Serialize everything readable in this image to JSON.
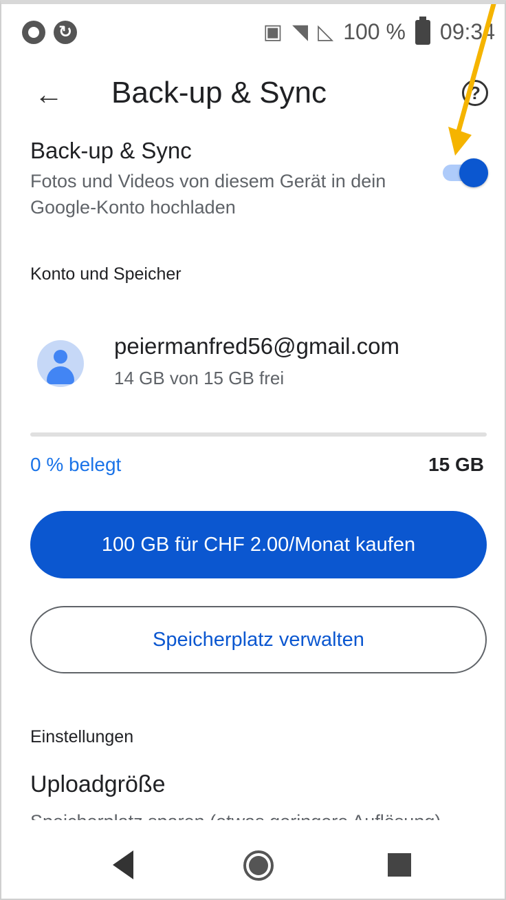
{
  "status_bar": {
    "battery": "100 %",
    "time": "09:34",
    "icons": [
      "circle-icon",
      "sync-icon",
      "cast-icon",
      "wifi-icon",
      "no-sim-icon",
      "battery-icon"
    ]
  },
  "toolbar": {
    "back_icon": "arrow-back-icon",
    "title": "Back-up & Sync",
    "help_icon": "help-icon"
  },
  "backup_setting": {
    "title": "Back-up & Sync",
    "description": "Fotos und Videos von diesem Gerät in dein Google-Konto hochladen",
    "enabled": true
  },
  "account_section": {
    "header": "Konto und Speicher",
    "email": "peiermanfred56@gmail.com",
    "storage_free": "14 GB von 15 GB frei",
    "used_label": "0 % belegt",
    "used_fraction": 0,
    "total": "15 GB",
    "buy_button": "100 GB für CHF 2.00/Monat kaufen",
    "manage_button": "Speicherplatz verwalten"
  },
  "settings_section": {
    "header": "Einstellungen",
    "upload_size_title": "Uploadgröße",
    "upload_size_sub": "Speicherplatz sparen (etwas geringere Auflösung)"
  },
  "colors": {
    "accent": "#0b57d0",
    "link": "#1a73e8",
    "annotation_arrow": "#f5b400"
  }
}
